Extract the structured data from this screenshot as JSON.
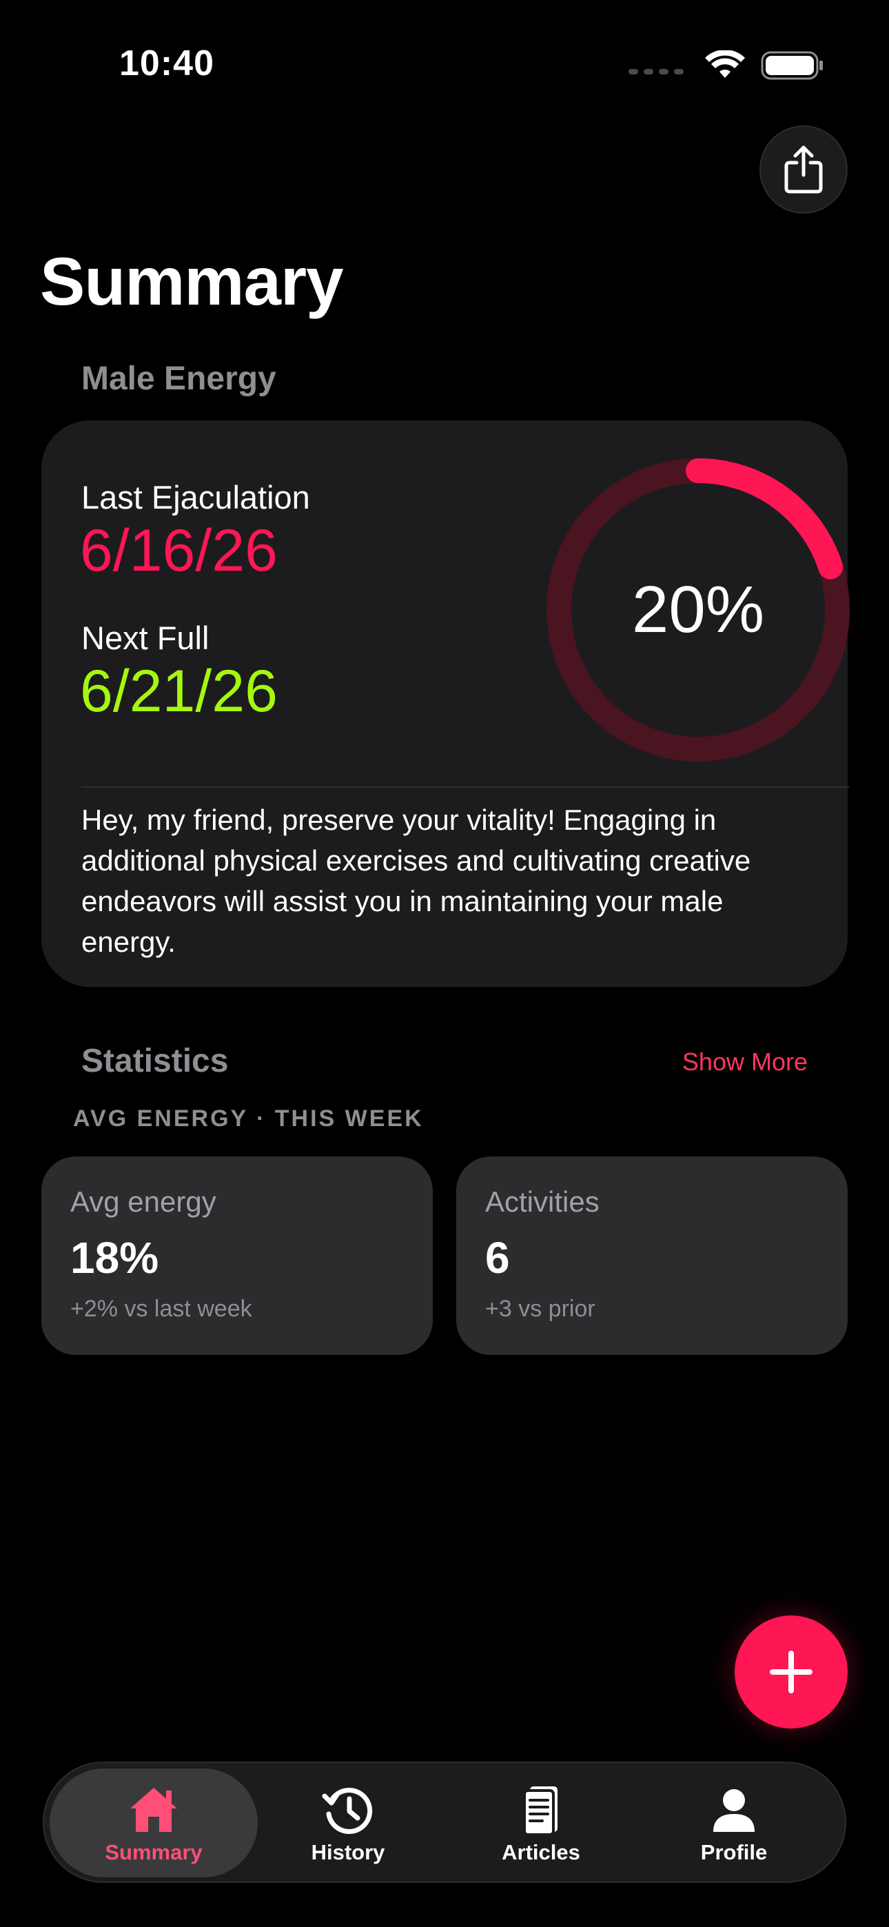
{
  "status_bar": {
    "time": "10:40"
  },
  "header": {
    "title": "Summary"
  },
  "energy": {
    "section_label": "Male Energy",
    "last_label": "Last Ejaculation",
    "last_date": "6/16/26",
    "next_label": "Next Full",
    "next_date": "6/21/26",
    "percent_text": "20%",
    "percent_value": 0.2,
    "message": "Hey, my friend, preserve your vitality! Engaging in additional physical exercises and cultivating creative endeavors will assist you in maintaining your male energy.",
    "colors": {
      "last_date": "#ff1654",
      "next_date": "#a6f70f",
      "ring": "#ff1654",
      "ring_track": "#4a1420"
    }
  },
  "statistics": {
    "section_label": "Statistics",
    "show_more_label": "Show More",
    "caption": "AVG ENERGY · THIS WEEK",
    "cards": [
      {
        "title": "Avg energy",
        "value": "18%",
        "delta": "+2% vs last week"
      },
      {
        "title": "Activities",
        "value": "6",
        "delta": "+3 vs prior"
      }
    ]
  },
  "fab": {
    "icon": "plus-icon",
    "color": "#ff1654"
  },
  "tabs": [
    {
      "label": "Summary",
      "icon": "house-icon",
      "active": true
    },
    {
      "label": "History",
      "icon": "history-icon",
      "active": false
    },
    {
      "label": "Articles",
      "icon": "articles-icon",
      "active": false
    },
    {
      "label": "Profile",
      "icon": "person-icon",
      "active": false
    }
  ]
}
